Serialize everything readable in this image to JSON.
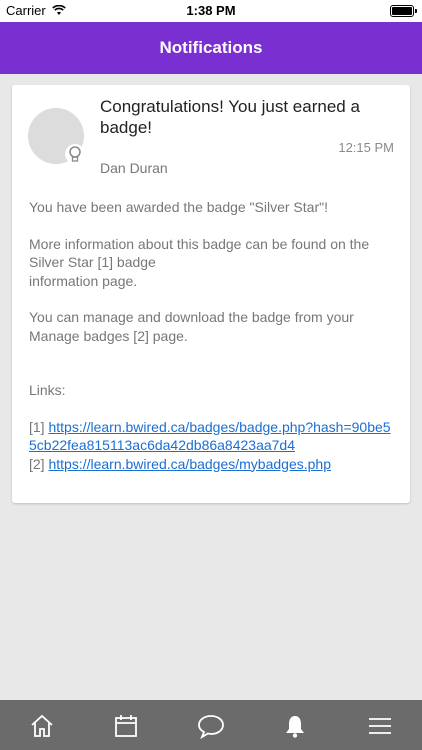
{
  "status_bar": {
    "carrier": "Carrier",
    "time": "1:38 PM"
  },
  "nav": {
    "title": "Notifications"
  },
  "notification": {
    "title": "Congratulations! You just earned a badge!",
    "time": "12:15 PM",
    "author": "Dan Duran",
    "body_line1": "You have been awarded the badge \"Silver Star\"!",
    "body_line2a": "More information about this badge can be found on the Silver Star [1] badge",
    "body_line2b": "information page.",
    "body_line3": "You can manage and download the badge from your Manage badges [2] page.",
    "links_label": "Links:",
    "link1_prefix": "[1]",
    "link1_url": "https://learn.bwired.ca/badges/badge.php?hash=90be55cb22fea815113ac6da42db86a8423aa7d4",
    "link2_prefix": "[2]",
    "link2_url": "https://learn.bwired.ca/badges/mybadges.php"
  },
  "tabs": [
    {
      "icon": "home-icon"
    },
    {
      "icon": "calendar-icon"
    },
    {
      "icon": "chat-icon"
    },
    {
      "icon": "bell-icon"
    },
    {
      "icon": "menu-icon"
    }
  ],
  "colors": {
    "accent": "#7a2fd1",
    "tab_bar": "#6b6b6b",
    "link": "#1a6fd4"
  }
}
